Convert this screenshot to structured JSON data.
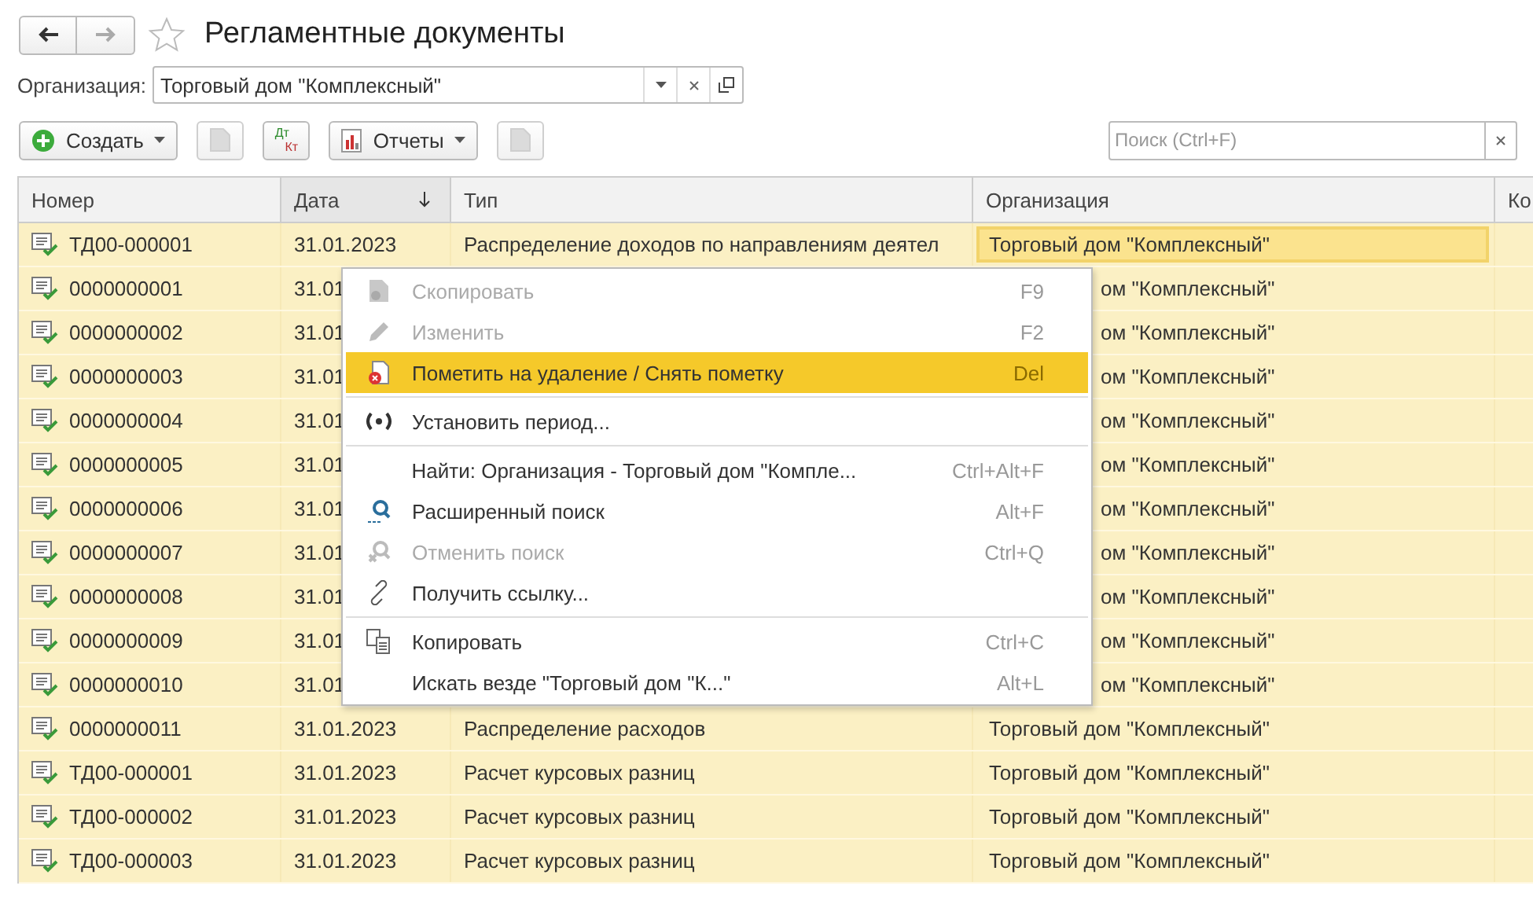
{
  "window": {
    "title": "Регламентные документы",
    "favorite": false
  },
  "filter": {
    "label": "Организация:",
    "value": "Торговый дом \"Комплексный\""
  },
  "toolbar": [
    {
      "kind": "create",
      "label": "Создать"
    },
    {
      "kind": "icon-disabled"
    },
    {
      "kind": "dtkt",
      "top": "Дт",
      "bottom": "Кт"
    },
    {
      "kind": "reports",
      "label": "Отчеты"
    },
    {
      "kind": "icon-disabled"
    }
  ],
  "search": {
    "placeholder": "Поиск (Ctrl+F)"
  },
  "table": {
    "columns": [
      {
        "label": "Номер",
        "sorted": false
      },
      {
        "label": "Дата",
        "sorted": true
      },
      {
        "label": "Тип",
        "sorted": false
      },
      {
        "label": "Организация",
        "sorted": false
      },
      {
        "label": "Ко",
        "sorted": false
      }
    ],
    "rows": [
      {
        "number": "ТД00-000001",
        "date": "31.01.2023",
        "type": "Распределение доходов по направлениям деятел",
        "org": "Торговый дом \"Комплексный\"",
        "selected": true,
        "covered": false
      },
      {
        "number": "0000000001",
        "date": "31.01",
        "org": "ом \"Комплексный\"",
        "selected": false,
        "covered": true
      },
      {
        "number": "0000000002",
        "date": "31.01",
        "org": "ом \"Комплексный\"",
        "selected": false,
        "covered": true
      },
      {
        "number": "0000000003",
        "date": "31.01",
        "org": "ом \"Комплексный\"",
        "selected": false,
        "covered": true
      },
      {
        "number": "0000000004",
        "date": "31.01",
        "org": "ом \"Комплексный\"",
        "selected": false,
        "covered": true
      },
      {
        "number": "0000000005",
        "date": "31.01",
        "org": "ом \"Комплексный\"",
        "selected": false,
        "covered": true
      },
      {
        "number": "0000000006",
        "date": "31.01",
        "org": "ом \"Комплексный\"",
        "selected": false,
        "covered": true
      },
      {
        "number": "0000000007",
        "date": "31.01",
        "org": "ом \"Комплексный\"",
        "selected": false,
        "covered": true
      },
      {
        "number": "0000000008",
        "date": "31.01",
        "org": "ом \"Комплексный\"",
        "selected": false,
        "covered": true
      },
      {
        "number": "0000000009",
        "date": "31.01",
        "org": "ом \"Комплексный\"",
        "selected": false,
        "covered": true
      },
      {
        "number": "0000000010",
        "date": "31.01",
        "org": "ом \"Комплексный\"",
        "selected": false,
        "covered": true
      },
      {
        "number": "0000000011",
        "date": "31.01.2023",
        "type": "Распределение расходов",
        "org": "Торговый дом \"Комплексный\"",
        "selected": false,
        "covered": false
      },
      {
        "number": "ТД00-000001",
        "date": "31.01.2023",
        "type": "Расчет курсовых разниц",
        "org": "Торговый дом \"Комплексный\"",
        "selected": false,
        "covered": false
      },
      {
        "number": "ТД00-000002",
        "date": "31.01.2023",
        "type": "Расчет курсовых разниц",
        "org": "Торговый дом \"Комплексный\"",
        "selected": false,
        "covered": false
      },
      {
        "number": "ТД00-000003",
        "date": "31.01.2023",
        "type": "Расчет курсовых разниц",
        "org": "Торговый дом \"Комплексный\"",
        "selected": false,
        "covered": false
      }
    ]
  },
  "context_menu": [
    {
      "kind": "duplicate",
      "label": "Скопировать",
      "shortcut": "F9",
      "disabled": true,
      "selected": false
    },
    {
      "kind": "edit",
      "label": "Изменить",
      "shortcut": "F2",
      "disabled": true,
      "selected": false
    },
    {
      "kind": "mark",
      "label": "Пометить на удаление / Снять пометку",
      "shortcut": "Del",
      "disabled": false,
      "selected": true
    },
    {
      "kind": "separator"
    },
    {
      "kind": "period",
      "label": "Установить период...",
      "disabled": false,
      "selected": false
    },
    {
      "kind": "separator"
    },
    {
      "kind": "find",
      "label": "Найти: Организация - Торговый дом \"Компле...",
      "shortcut": "Ctrl+Alt+F",
      "disabled": false,
      "selected": false
    },
    {
      "kind": "search",
      "label": "Расширенный поиск",
      "shortcut": "Alt+F",
      "disabled": false,
      "selected": false
    },
    {
      "kind": "cancel",
      "label": "Отменить поиск",
      "shortcut": "Ctrl+Q",
      "disabled": true,
      "selected": false
    },
    {
      "kind": "link",
      "label": "Получить ссылку...",
      "disabled": false,
      "selected": false
    },
    {
      "kind": "separator"
    },
    {
      "kind": "copy",
      "label": "Копировать",
      "shortcut": "Ctrl+C",
      "disabled": false,
      "selected": false
    },
    {
      "kind": "findall",
      "label": "Искать везде \"Торговый дом \"К...\"",
      "shortcut": "Alt+L",
      "disabled": false,
      "selected": false
    }
  ]
}
